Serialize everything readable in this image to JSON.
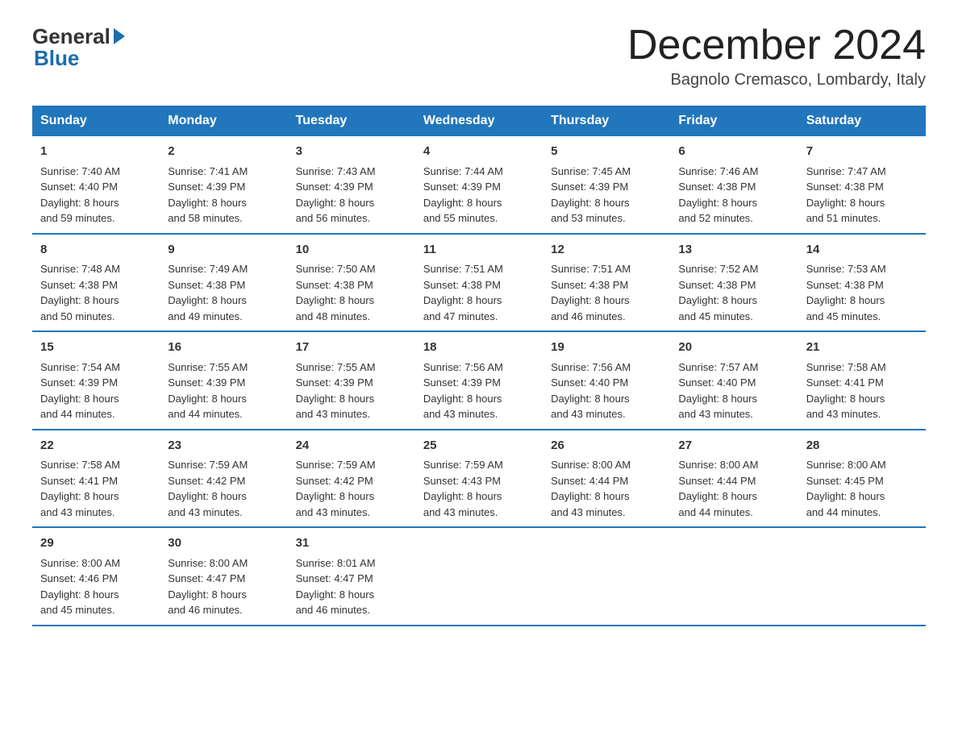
{
  "logo": {
    "general": "General",
    "blue": "Blue"
  },
  "title": "December 2024",
  "location": "Bagnolo Cremasco, Lombardy, Italy",
  "headers": [
    "Sunday",
    "Monday",
    "Tuesday",
    "Wednesday",
    "Thursday",
    "Friday",
    "Saturday"
  ],
  "weeks": [
    [
      {
        "day": "1",
        "info": "Sunrise: 7:40 AM\nSunset: 4:40 PM\nDaylight: 8 hours\nand 59 minutes."
      },
      {
        "day": "2",
        "info": "Sunrise: 7:41 AM\nSunset: 4:39 PM\nDaylight: 8 hours\nand 58 minutes."
      },
      {
        "day": "3",
        "info": "Sunrise: 7:43 AM\nSunset: 4:39 PM\nDaylight: 8 hours\nand 56 minutes."
      },
      {
        "day": "4",
        "info": "Sunrise: 7:44 AM\nSunset: 4:39 PM\nDaylight: 8 hours\nand 55 minutes."
      },
      {
        "day": "5",
        "info": "Sunrise: 7:45 AM\nSunset: 4:39 PM\nDaylight: 8 hours\nand 53 minutes."
      },
      {
        "day": "6",
        "info": "Sunrise: 7:46 AM\nSunset: 4:38 PM\nDaylight: 8 hours\nand 52 minutes."
      },
      {
        "day": "7",
        "info": "Sunrise: 7:47 AM\nSunset: 4:38 PM\nDaylight: 8 hours\nand 51 minutes."
      }
    ],
    [
      {
        "day": "8",
        "info": "Sunrise: 7:48 AM\nSunset: 4:38 PM\nDaylight: 8 hours\nand 50 minutes."
      },
      {
        "day": "9",
        "info": "Sunrise: 7:49 AM\nSunset: 4:38 PM\nDaylight: 8 hours\nand 49 minutes."
      },
      {
        "day": "10",
        "info": "Sunrise: 7:50 AM\nSunset: 4:38 PM\nDaylight: 8 hours\nand 48 minutes."
      },
      {
        "day": "11",
        "info": "Sunrise: 7:51 AM\nSunset: 4:38 PM\nDaylight: 8 hours\nand 47 minutes."
      },
      {
        "day": "12",
        "info": "Sunrise: 7:51 AM\nSunset: 4:38 PM\nDaylight: 8 hours\nand 46 minutes."
      },
      {
        "day": "13",
        "info": "Sunrise: 7:52 AM\nSunset: 4:38 PM\nDaylight: 8 hours\nand 45 minutes."
      },
      {
        "day": "14",
        "info": "Sunrise: 7:53 AM\nSunset: 4:38 PM\nDaylight: 8 hours\nand 45 minutes."
      }
    ],
    [
      {
        "day": "15",
        "info": "Sunrise: 7:54 AM\nSunset: 4:39 PM\nDaylight: 8 hours\nand 44 minutes."
      },
      {
        "day": "16",
        "info": "Sunrise: 7:55 AM\nSunset: 4:39 PM\nDaylight: 8 hours\nand 44 minutes."
      },
      {
        "day": "17",
        "info": "Sunrise: 7:55 AM\nSunset: 4:39 PM\nDaylight: 8 hours\nand 43 minutes."
      },
      {
        "day": "18",
        "info": "Sunrise: 7:56 AM\nSunset: 4:39 PM\nDaylight: 8 hours\nand 43 minutes."
      },
      {
        "day": "19",
        "info": "Sunrise: 7:56 AM\nSunset: 4:40 PM\nDaylight: 8 hours\nand 43 minutes."
      },
      {
        "day": "20",
        "info": "Sunrise: 7:57 AM\nSunset: 4:40 PM\nDaylight: 8 hours\nand 43 minutes."
      },
      {
        "day": "21",
        "info": "Sunrise: 7:58 AM\nSunset: 4:41 PM\nDaylight: 8 hours\nand 43 minutes."
      }
    ],
    [
      {
        "day": "22",
        "info": "Sunrise: 7:58 AM\nSunset: 4:41 PM\nDaylight: 8 hours\nand 43 minutes."
      },
      {
        "day": "23",
        "info": "Sunrise: 7:59 AM\nSunset: 4:42 PM\nDaylight: 8 hours\nand 43 minutes."
      },
      {
        "day": "24",
        "info": "Sunrise: 7:59 AM\nSunset: 4:42 PM\nDaylight: 8 hours\nand 43 minutes."
      },
      {
        "day": "25",
        "info": "Sunrise: 7:59 AM\nSunset: 4:43 PM\nDaylight: 8 hours\nand 43 minutes."
      },
      {
        "day": "26",
        "info": "Sunrise: 8:00 AM\nSunset: 4:44 PM\nDaylight: 8 hours\nand 43 minutes."
      },
      {
        "day": "27",
        "info": "Sunrise: 8:00 AM\nSunset: 4:44 PM\nDaylight: 8 hours\nand 44 minutes."
      },
      {
        "day": "28",
        "info": "Sunrise: 8:00 AM\nSunset: 4:45 PM\nDaylight: 8 hours\nand 44 minutes."
      }
    ],
    [
      {
        "day": "29",
        "info": "Sunrise: 8:00 AM\nSunset: 4:46 PM\nDaylight: 8 hours\nand 45 minutes."
      },
      {
        "day": "30",
        "info": "Sunrise: 8:00 AM\nSunset: 4:47 PM\nDaylight: 8 hours\nand 46 minutes."
      },
      {
        "day": "31",
        "info": "Sunrise: 8:01 AM\nSunset: 4:47 PM\nDaylight: 8 hours\nand 46 minutes."
      },
      {
        "day": "",
        "info": ""
      },
      {
        "day": "",
        "info": ""
      },
      {
        "day": "",
        "info": ""
      },
      {
        "day": "",
        "info": ""
      }
    ]
  ]
}
